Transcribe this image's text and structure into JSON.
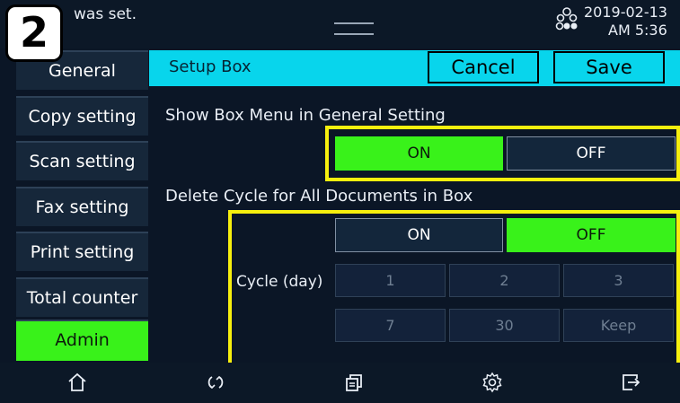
{
  "step_badge": "2",
  "status": {
    "message": "was set.",
    "date": "2019-02-13",
    "time": "AM 5:36",
    "network_icon": "network-icon"
  },
  "sidebar": {
    "items": [
      {
        "label": "General",
        "active": false
      },
      {
        "label": "Copy setting",
        "active": false
      },
      {
        "label": "Scan setting",
        "active": false
      },
      {
        "label": "Fax setting",
        "active": false
      },
      {
        "label": "Print setting",
        "active": false
      },
      {
        "label": "Total counter",
        "active": false
      },
      {
        "label": "Admin",
        "active": true
      }
    ]
  },
  "header": {
    "title": "Setup Box",
    "cancel_label": "Cancel",
    "save_label": "Save"
  },
  "show_box_menu": {
    "label": "Show Box Menu in General Setting",
    "on_label": "ON",
    "off_label": "OFF",
    "selected": "ON"
  },
  "delete_cycle": {
    "label": "Delete Cycle for All Documents in Box",
    "on_label": "ON",
    "off_label": "OFF",
    "selected": "OFF",
    "cycle_label": "Cycle (day)",
    "options": [
      "1",
      "2",
      "3",
      "7",
      "30",
      "Keep"
    ]
  },
  "bottom_nav": [
    "home-icon",
    "rotate-icon",
    "copy-icon",
    "settings-icon",
    "logout-icon"
  ],
  "colors": {
    "accent_header": "#08d5ec",
    "active_green": "#39f21a",
    "highlight": "#f7ef0e",
    "background": "#0b1626"
  }
}
